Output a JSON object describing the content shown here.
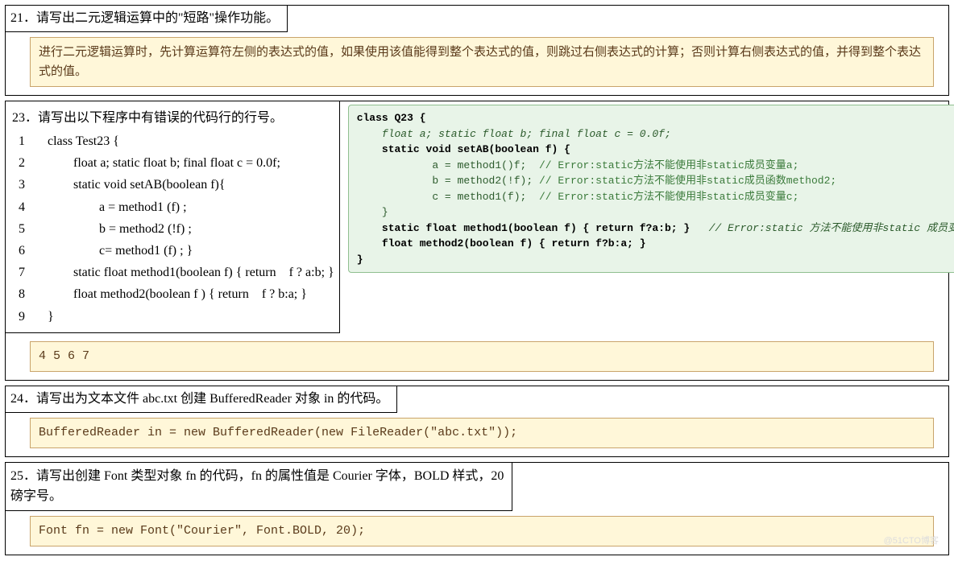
{
  "q21": {
    "title": "21．请写出二元逻辑运算中的\"短路\"操作功能。",
    "answer": "进行二元逻辑运算时，先计算运算符左侧的表达式的值，如果使用该值能得到整个表达式的值，则跳过右侧表达式的计算；否则计算右侧表达式的值，并得到整个表达式的值。"
  },
  "q23": {
    "title": "23．请写出以下程序中有错误的代码行的行号。",
    "lines": [
      {
        "n": "1",
        "t": "class Test23 {"
      },
      {
        "n": "2",
        "t": "        float a; static float b; final float c = 0.0f;"
      },
      {
        "n": "3",
        "t": "        static void setAB(boolean f){"
      },
      {
        "n": "4",
        "t": "                a = method1 (f) ;"
      },
      {
        "n": "5",
        "t": "                b = method2 (!f) ;"
      },
      {
        "n": "6",
        "t": "                c= method1 (f) ; }"
      },
      {
        "n": "7",
        "t": "        static float method1(boolean f) { return    f ? a:b; }"
      },
      {
        "n": "8",
        "t": "        float method2(boolean f ) { return    f ? b:a; }"
      },
      {
        "n": "9",
        "t": "}"
      }
    ],
    "right_code": {
      "l1": "class Q23 {",
      "l2": "    float a; static float b; final float c = 0.0f;",
      "l3": "    static void setAB(boolean f) {",
      "l4a": "            a = method1()f;  ",
      "l4c": "// Error:static方法不能使用非static成员变量a;",
      "l5a": "            b = method2(!f); ",
      "l5c": "// Error:static方法不能使用非static成员函数method2;",
      "l6a": "            c = method1(f);  ",
      "l6c": "// Error:static方法不能使用非static成员变量c;",
      "l7": "    }",
      "l8a": "    static float method1(boolean f) { return f?a:b; }   ",
      "l8c": "// Error:static 方法不能使用非static 成员变量a;",
      "l9": "    float method2(boolean f) { return f?b:a; }",
      "l10": "}"
    },
    "answer": "4 5 6 7"
  },
  "q24": {
    "title": "24．请写出为文本文件 abc.txt 创建 BufferedReader 对象 in 的代码。",
    "answer": "BufferedReader in = new BufferedReader(new FileReader(\"abc.txt\"));"
  },
  "q25": {
    "title_a": "25．请写出创建 Font 类型对象 fn 的代码，fn 的属性值是 Courier 字体，BOLD 样式，20",
    "title_b": "磅字号。",
    "answer": "Font fn = new Font(\"Courier\", Font.BOLD, 20);"
  },
  "watermark": "@51CTO博客"
}
